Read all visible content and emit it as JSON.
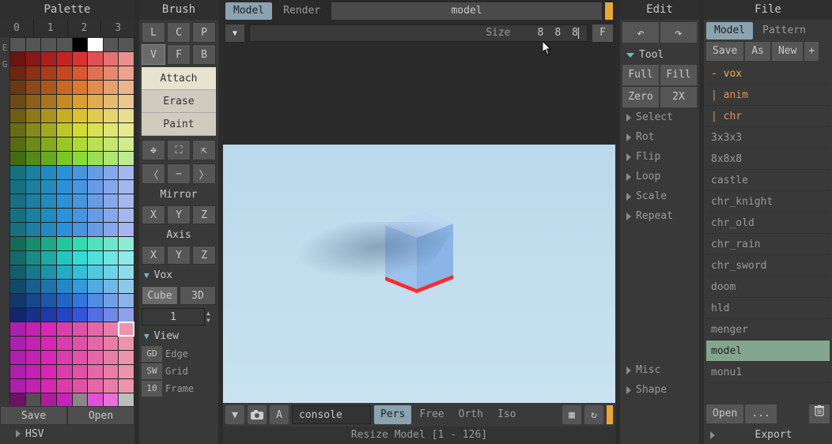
{
  "palette": {
    "title": "Palette",
    "indices": [
      "0",
      "1",
      "2",
      "3"
    ],
    "sideLabels": [
      "E",
      "G"
    ],
    "rows": 27,
    "cols": 8,
    "selected_index": 167,
    "btn_save": "Save",
    "btn_open": "Open",
    "hsv": "HSV"
  },
  "brush": {
    "title": "Brush",
    "grid": [
      "L",
      "C",
      "P",
      "V",
      "F",
      "B"
    ],
    "grid_active": 3,
    "modes": [
      "Attach",
      "Erase",
      "Paint"
    ],
    "mode_active": 0,
    "mirror": "Mirror",
    "axis": "Axis",
    "xyz": [
      "X",
      "Y",
      "Z"
    ],
    "vox": "Vox",
    "vox_opts": [
      "Cube",
      "3D"
    ],
    "vox_active": 0,
    "vox_count": "1",
    "view": "View",
    "view_rows": [
      [
        "GD",
        "Edge"
      ],
      [
        "SW",
        "Grid"
      ],
      [
        "10",
        "Frame"
      ]
    ]
  },
  "center": {
    "tabs": [
      "Model",
      "Render"
    ],
    "tab_active": 0,
    "model_name": "model",
    "size_label": "Size",
    "size_vals": [
      "8",
      "8",
      "8"
    ],
    "f_btn": "F",
    "console_ph": "console",
    "proj": [
      "Pers",
      "Free",
      "Orth",
      "Iso"
    ],
    "proj_active": 0,
    "status": "Resize Model [1 - 126]",
    "a_btn": "A"
  },
  "edit": {
    "title": "Edit",
    "tool": "Tool",
    "tool_grid": [
      "Full",
      "Fill",
      "Zero",
      "2X"
    ],
    "sections": [
      "Select",
      "Rot",
      "Flip",
      "Loop",
      "Scale",
      "Repeat",
      "",
      "Misc",
      "Shape"
    ],
    "select_open": true
  },
  "file": {
    "title": "File",
    "tabs": [
      "Model",
      "Pattern"
    ],
    "tab_active": 0,
    "acts": [
      "Save",
      "As",
      "New"
    ],
    "plus": "+",
    "items": [
      {
        "label": "- vox",
        "cls": "y"
      },
      {
        "label": "  | anim",
        "cls": "o"
      },
      {
        "label": "  | chr",
        "cls": "o"
      },
      {
        "label": "3x3x3",
        "cls": ""
      },
      {
        "label": "8x8x8",
        "cls": ""
      },
      {
        "label": "castle",
        "cls": ""
      },
      {
        "label": "chr_knight",
        "cls": ""
      },
      {
        "label": "chr_old",
        "cls": ""
      },
      {
        "label": "chr_rain",
        "cls": ""
      },
      {
        "label": "chr_sword",
        "cls": ""
      },
      {
        "label": "doom",
        "cls": ""
      },
      {
        "label": "hld",
        "cls": ""
      },
      {
        "label": "menger",
        "cls": ""
      },
      {
        "label": "model",
        "cls": "sel"
      },
      {
        "label": "monu1",
        "cls": ""
      }
    ],
    "open": "Open",
    "more": "...",
    "export": "Export"
  },
  "colors": {
    "accent": "#e8a838"
  }
}
